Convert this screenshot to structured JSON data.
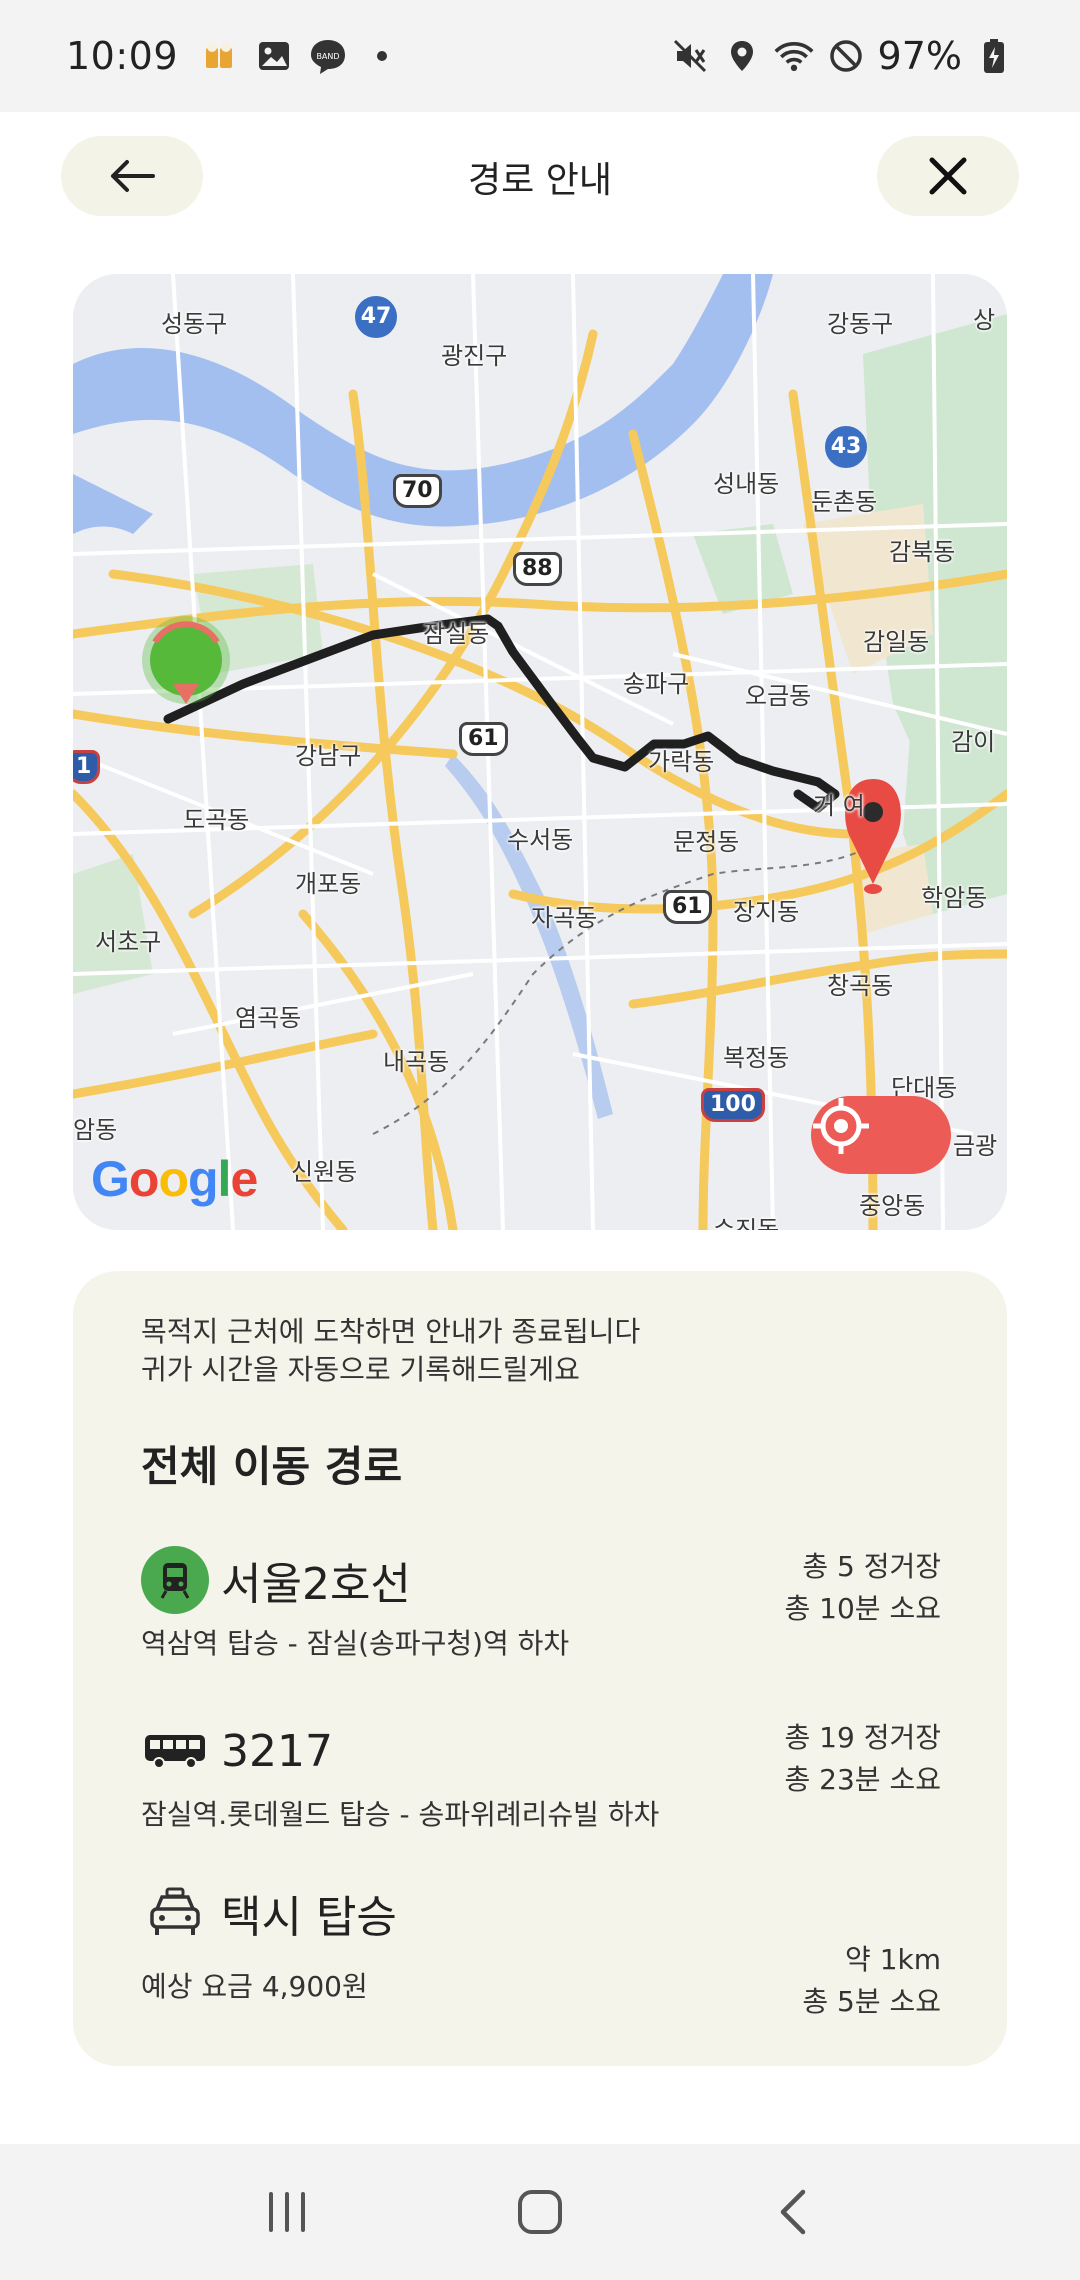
{
  "status_bar": {
    "time": "10:09",
    "battery": "97%",
    "left_icons": [
      "beer-icon",
      "gallery-icon",
      "band-icon",
      "dot-icon"
    ],
    "right_icons": [
      "mute-icon",
      "location-icon",
      "wifi-icon",
      "do-not-disturb-icon",
      "battery-charging-icon"
    ],
    "band_text": "BAND"
  },
  "header": {
    "title": "경로 안내",
    "back_icon": "arrow-left-icon",
    "close_icon": "close-icon"
  },
  "map": {
    "google_logo": "Google",
    "locate_icon": "crosshair-icon",
    "route_color": "#1f1f1f",
    "start_marker_color": "#56b93a",
    "end_marker_color": "#e84a44",
    "labels": {
      "seongdong": "성동구",
      "gwangjin": "광진구",
      "gangdong": "강동구",
      "sang": "상",
      "seongnae": "성내동",
      "dunchon": "둔촌동",
      "gambuk": "감북동",
      "gamil": "감일동",
      "jamsil": "잠실동",
      "songpa": "송파구",
      "ogeum": "오금동",
      "gami": "감이",
      "gangnam": "강남구",
      "garak": "가락동",
      "geoyeo": "거 여",
      "dogok": "도곡동",
      "suseo": "수서동",
      "munjeong": "문정동",
      "gaepo": "개포동",
      "hakam": "학암동",
      "seocho": "서초구",
      "jagok": "자곡동",
      "jangji": "장지동",
      "changgok": "창곡동",
      "yeomgok": "염곡동",
      "naegok": "내곡동",
      "bokjeong": "복정동",
      "dandae": "단대동",
      "amdong": "암동",
      "sinwon": "신원동",
      "geumgwang": "금광",
      "jungang": "중앙동",
      "sujin": "수진동"
    },
    "road_badges": {
      "r47": "47",
      "r70": "70",
      "r88": "88",
      "r43": "43",
      "r61a": "61",
      "r61b": "61",
      "r100": "100",
      "r1": "1"
    }
  },
  "info": {
    "notice_line1": "목적지 근처에 도착하면 안내가 종료됩니다",
    "notice_line2": "귀가 시간을 자동으로 기록해드릴게요",
    "section_title": "전체 이동 경로",
    "routes": [
      {
        "icon": "subway-icon",
        "name": "서울2호선",
        "desc": "역삼역 탑승 - 잠실(송파구청)역 하차",
        "meta_line1": "총 5 정거장",
        "meta_line2": "총 10분 소요"
      },
      {
        "icon": "bus-icon",
        "name": "3217",
        "desc": "잠실역.롯데월드 탑승 - 송파위례리슈빌 하차",
        "meta_line1": "총 19 정거장",
        "meta_line2": "총 23분 소요"
      },
      {
        "icon": "taxi-icon",
        "name": "택시 탑승",
        "desc": "예상 요금 4,900원",
        "meta_line1": "약 1km",
        "meta_line2": "총 5분 소요"
      }
    ]
  },
  "nav_bar": {
    "recent_icon": "recent-apps-icon",
    "home_icon": "home-icon",
    "back_icon": "back-icon"
  }
}
